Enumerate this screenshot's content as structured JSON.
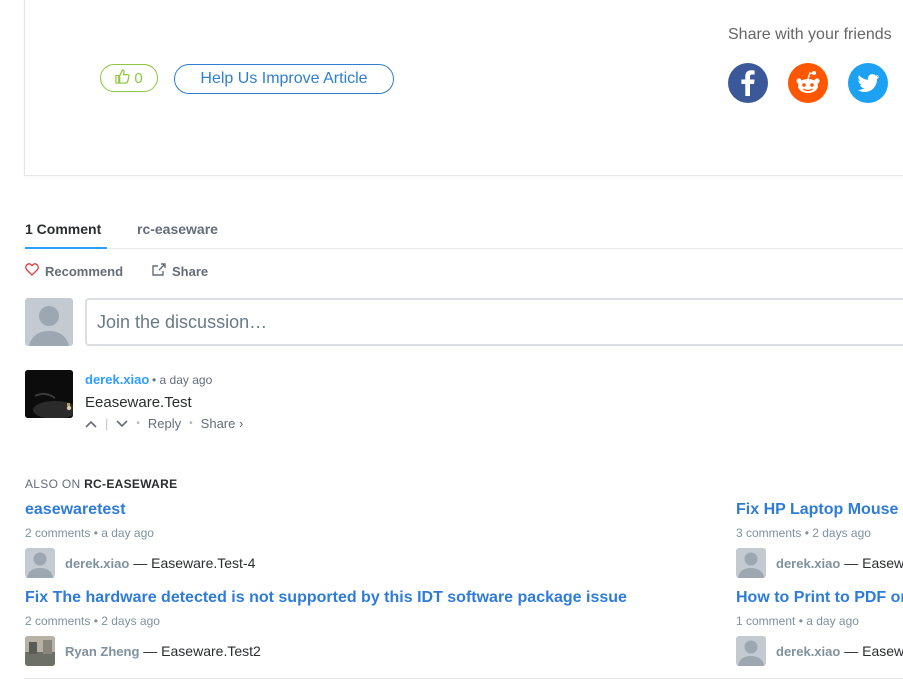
{
  "article": {
    "like_count": "0",
    "improve_label": "Help Us Improve Article",
    "share_title": "Share with your friends",
    "social": [
      {
        "name": "facebook-icon",
        "color": "#3b5998"
      },
      {
        "name": "reddit-icon",
        "color": "#ff5700"
      },
      {
        "name": "twitter-icon",
        "color": "#1da1f2"
      }
    ]
  },
  "tabs": {
    "comments": "1 Comment",
    "site": "rc-easeware"
  },
  "actions": {
    "recommend": "Recommend",
    "share": "Share"
  },
  "composer": {
    "placeholder": "Join the discussion…"
  },
  "comment": {
    "author": "derek.xiao",
    "meta": "• a day ago",
    "body": "Eeaseware.Test",
    "reply": "Reply",
    "share": "Share ›",
    "dot": "•"
  },
  "also_on": {
    "prefix": "ALSO ON",
    "site": "RC-EASEWARE",
    "items": [
      {
        "title": "easewaretest",
        "meta": "2 comments • a day ago",
        "user": "derek.xiao",
        "text": "— Easeware.Test-4"
      },
      {
        "title": "Fix HP Laptop Mouse",
        "meta": "3 comments • 2 days ago",
        "user": "derek.xiao",
        "text": "— Easew"
      },
      {
        "title": "Fix The hardware detected is not supported by this IDT software package issue",
        "meta": "2 comments • 2 days ago",
        "user": "Ryan Zheng",
        "text": "— Easeware.Test2"
      },
      {
        "title": "How to Print to PDF on",
        "meta": "1 comment • a day ago",
        "user": "derek.xiao",
        "text": "— Easew"
      }
    ]
  },
  "colors": {
    "accent": "#2e9fff",
    "link": "#2e7cd8",
    "like_green": "#8dc63f",
    "improve_blue": "#2f7fce"
  }
}
